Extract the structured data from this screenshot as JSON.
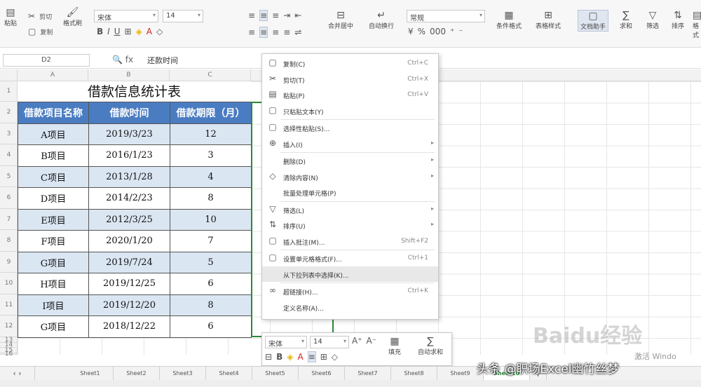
{
  "toolbar": {
    "paste": "粘贴",
    "cut": "剪切",
    "copy": "复制",
    "format_painter": "格式刷",
    "font": "宋体",
    "size": "14",
    "merge_center": "合并居中",
    "wrap": "自动换行",
    "number_format": "常规",
    "cond_format": "条件格式",
    "table_style": "表格样式",
    "doc_helper": "文档助手",
    "sum": "求和",
    "filter": "筛选",
    "sort": "排序",
    "format": "格式"
  },
  "formula": {
    "cell": "D2",
    "value": "还款时间"
  },
  "columns": [
    "A",
    "B",
    "C"
  ],
  "rows": [
    "1",
    "2",
    "3",
    "4",
    "5",
    "6",
    "7",
    "8",
    "9",
    "10",
    "11",
    "12",
    "13",
    "14",
    "15",
    "16"
  ],
  "sheet": {
    "title": "借款信息统计表",
    "headers": [
      "借款项目名称",
      "借款时间",
      "借款期限（月）"
    ],
    "data": [
      [
        "A项目",
        "2019/3/23",
        "12"
      ],
      [
        "B项目",
        "2016/1/23",
        "3"
      ],
      [
        "C项目",
        "2013/1/28",
        "4"
      ],
      [
        "D项目",
        "2014/2/23",
        "8"
      ],
      [
        "E项目",
        "2012/3/25",
        "10"
      ],
      [
        "F项目",
        "2020/1/20",
        "7"
      ],
      [
        "G项目",
        "2019/7/24",
        "5"
      ],
      [
        "H项目",
        "2019/12/25",
        "6"
      ],
      [
        "I项目",
        "2019/12/20",
        "8"
      ],
      [
        "G项目",
        "2018/12/22",
        "6"
      ]
    ]
  },
  "menu": [
    {
      "icon": "▢",
      "label": "复制(C)",
      "shortcut": "Ctrl+C"
    },
    {
      "icon": "✂",
      "label": "剪切(T)",
      "shortcut": "Ctrl+X"
    },
    {
      "icon": "▤",
      "label": "粘贴(P)",
      "shortcut": "Ctrl+V"
    },
    {
      "icon": "▢",
      "label": "只粘贴文本(Y)",
      "shortcut": ""
    },
    {
      "icon": "▢",
      "label": "选择性粘贴(S)...",
      "shortcut": ""
    },
    {
      "icon": "⊕",
      "label": "插入(I)",
      "shortcut": "",
      "arrow": "▸"
    },
    {
      "icon": "",
      "label": "删除(D)",
      "shortcut": "",
      "arrow": "▸"
    },
    {
      "icon": "◇",
      "label": "清除内容(N)",
      "shortcut": "",
      "arrow": "▸"
    },
    {
      "icon": "",
      "label": "批量处理单元格(P)",
      "shortcut": ""
    },
    {
      "icon": "▽",
      "label": "筛选(L)",
      "shortcut": "",
      "arrow": "▸"
    },
    {
      "icon": "⇅",
      "label": "排序(U)",
      "shortcut": "",
      "arrow": "▸"
    },
    {
      "icon": "▢",
      "label": "插入批注(M)...",
      "shortcut": "Shift+F2"
    },
    {
      "icon": "▢",
      "label": "设置单元格格式(F)...",
      "shortcut": "Ctrl+1"
    },
    {
      "icon": "",
      "label": "从下拉列表中选择(K)...",
      "shortcut": ""
    },
    {
      "icon": "∞",
      "label": "超链接(H)...",
      "shortcut": "Ctrl+K"
    },
    {
      "icon": "",
      "label": "定义名称(A)...",
      "shortcut": ""
    }
  ],
  "mini": {
    "font": "宋体",
    "size": "14",
    "fill_label": "填充",
    "sum_label": "自动求和"
  },
  "tabs": [
    "Sheet1",
    "Sheet2",
    "Sheet3",
    "Sheet4",
    "Sheet5",
    "Sheet6",
    "Sheet7",
    "Sheet8",
    "Sheet9",
    "Sheet10"
  ],
  "watermark": {
    "brand": "Baidu经验",
    "win": "激活 Windo",
    "credit": "头条 @职场Excel幽竹丝梦"
  }
}
